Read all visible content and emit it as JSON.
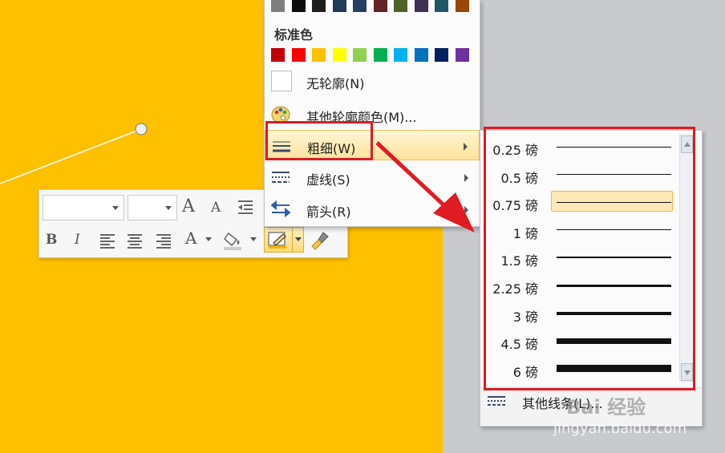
{
  "top_colors": [
    "#7f7f7f",
    "#0c0c0c",
    "#1e1e1e",
    "#1f3b57",
    "#243f60",
    "#632423",
    "#4f6228",
    "#3f3151",
    "#205867",
    "#974706"
  ],
  "standard_colors_title": "标准色",
  "standard_colors": [
    "#c00000",
    "#ff0000",
    "#ffc000",
    "#ffff00",
    "#92d050",
    "#00b050",
    "#00b0f0",
    "#0070c0",
    "#002060",
    "#7030a0"
  ],
  "menu": {
    "no_outline": "无轮廓(N)",
    "more_colors": "其他轮廓颜色(M)...",
    "weight": "粗细(W)",
    "dashes": "虚线(S)",
    "arrows": "箭头(R)"
  },
  "mini_toolbar": {
    "grow_font": "A",
    "shrink_font": "A",
    "bold": "B",
    "italic": "I",
    "font_color": "A"
  },
  "weights": [
    {
      "label": "0.25 磅",
      "pt": 0.25
    },
    {
      "label": "0.5 磅",
      "pt": 0.5
    },
    {
      "label": "0.75 磅",
      "pt": 0.75,
      "selected": true
    },
    {
      "label": "1 磅",
      "pt": 1
    },
    {
      "label": "1.5 磅",
      "pt": 1.5
    },
    {
      "label": "2.25 磅",
      "pt": 2.25
    },
    {
      "label": "3 磅",
      "pt": 3
    },
    {
      "label": "4.5 磅",
      "pt": 4.5
    },
    {
      "label": "6 磅",
      "pt": 6
    }
  ],
  "more_lines": "其他线条(L)...",
  "watermark": {
    "brand": "Bai 经验",
    "url": "jingyan.baidu.com"
  }
}
